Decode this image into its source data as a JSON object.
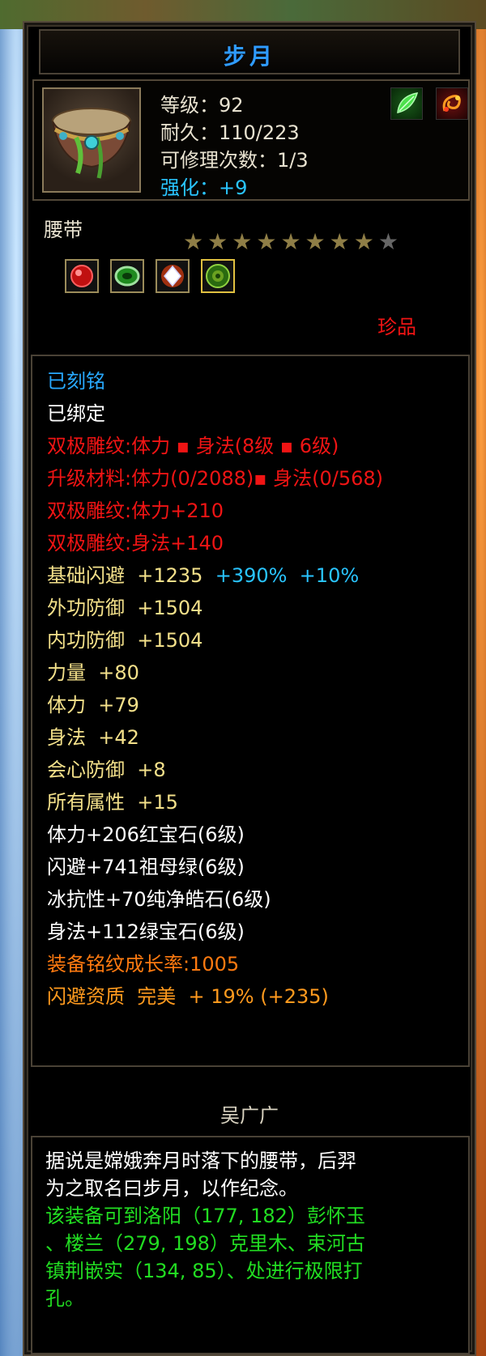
{
  "item": {
    "name": "步月",
    "level_label": "等级：",
    "level": "92",
    "durability_label": "耐久：",
    "durability": "110/223",
    "repair_label": "可修理次数：",
    "repair_count": "1/3",
    "enhance_label": "强化：",
    "enhance": "+9",
    "type": "腰带",
    "stars_filled": 8,
    "stars_total": 9,
    "rarity": "珍品",
    "icon": "belt-icon",
    "buff_icons": [
      "green-leaf-buff-icon",
      "fire-swirl-buff-icon"
    ],
    "gem_icons": [
      "ruby-gem-icon",
      "emerald-gem-icon",
      "diamond-gem-icon",
      "green-jade-gem-icon"
    ]
  },
  "attributes": [
    {
      "text": "已刻铭",
      "color": "#28a9ff"
    },
    {
      "text": "已绑定",
      "color": "#ffffff"
    },
    {
      "text": "双极雕纹:体力 ▪ 身法(8级 ▪ 6级)",
      "color": "#f01414"
    },
    {
      "text": "升级材料:体力(0/2088)▪ 身法(0/568)",
      "color": "#f01414"
    },
    {
      "text": "双极雕纹:体力+210",
      "color": "#f01414"
    },
    {
      "text": "双极雕纹:身法+140",
      "color": "#f01414"
    },
    {
      "text": "基础闪避  +1235  ",
      "color": "#f3e08a",
      "extra": [
        {
          "text": "+390%  +10%",
          "color": "#29c4ff"
        }
      ]
    },
    {
      "text": "外功防御  +1504",
      "color": "#f3e08a"
    },
    {
      "text": "内功防御  +1504",
      "color": "#f3e08a"
    },
    {
      "text": "力量  +80",
      "color": "#f3e08a"
    },
    {
      "text": "体力  +79",
      "color": "#f3e08a"
    },
    {
      "text": "身法  +42",
      "color": "#f3e08a"
    },
    {
      "text": "会心防御  +8",
      "color": "#f3e08a"
    },
    {
      "text": "所有属性  +15",
      "color": "#f3e08a"
    },
    {
      "text": "体力+206红宝石(6级)",
      "color": "#ffffff"
    },
    {
      "text": "闪避+741祖母绿(6级)",
      "color": "#ffffff"
    },
    {
      "text": "冰抗性+70纯净皓石(6级)",
      "color": "#ffffff"
    },
    {
      "text": "身法+112绿宝石(6级)",
      "color": "#ffffff"
    },
    {
      "text": "装备铭纹成长率:1005",
      "color": "#ff7a10"
    },
    {
      "text": "闪避资质  完美  + 19% (+235)",
      "color": "#ff9a1e"
    }
  ],
  "author": "吴广广",
  "description": [
    {
      "text": "据说是嫦娥奔月时落下的腰带，后羿",
      "color": "#ffffff"
    },
    {
      "text": "为之取名曰步月，以作纪念。",
      "color": "#ffffff"
    },
    {
      "text": "该装备可到洛阳（177, 182）彭怀玉",
      "color": "#22dd22"
    },
    {
      "text": "、楼兰（279, 198）克里木、束河古",
      "color": "#22dd22"
    },
    {
      "text": "镇荆嵌实（134, 85）、处进行极限打",
      "color": "#22dd22"
    },
    {
      "text": "孔。",
      "color": "#22dd22"
    }
  ]
}
